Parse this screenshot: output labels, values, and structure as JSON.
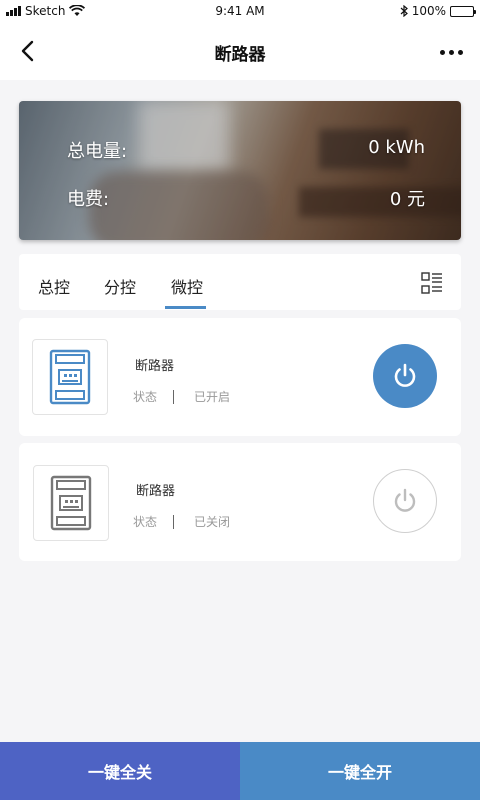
{
  "status_bar": {
    "carrier": "Sketch",
    "time": "9:41 AM",
    "battery": "100%"
  },
  "nav": {
    "title": "断路器"
  },
  "banner": {
    "energy_label": "总电量:",
    "energy_value": "0 kWh",
    "cost_label": "电费:",
    "cost_value": "0 元"
  },
  "tabs": [
    {
      "label": "总控"
    },
    {
      "label": "分控"
    },
    {
      "label": "微控",
      "active": true
    }
  ],
  "devices": [
    {
      "name": "断路器",
      "status_label": "状态",
      "status_value": "已开启",
      "on": true,
      "color": "#4a8ac6"
    },
    {
      "name": "断路器",
      "status_label": "状态",
      "status_value": "已关闭",
      "on": false,
      "color": "#777777"
    }
  ],
  "bottom": {
    "all_off_label": "一键全关",
    "all_on_label": "一键全开"
  },
  "colors": {
    "accent": "#4a8ac6",
    "off_button": "#4e63c4"
  }
}
